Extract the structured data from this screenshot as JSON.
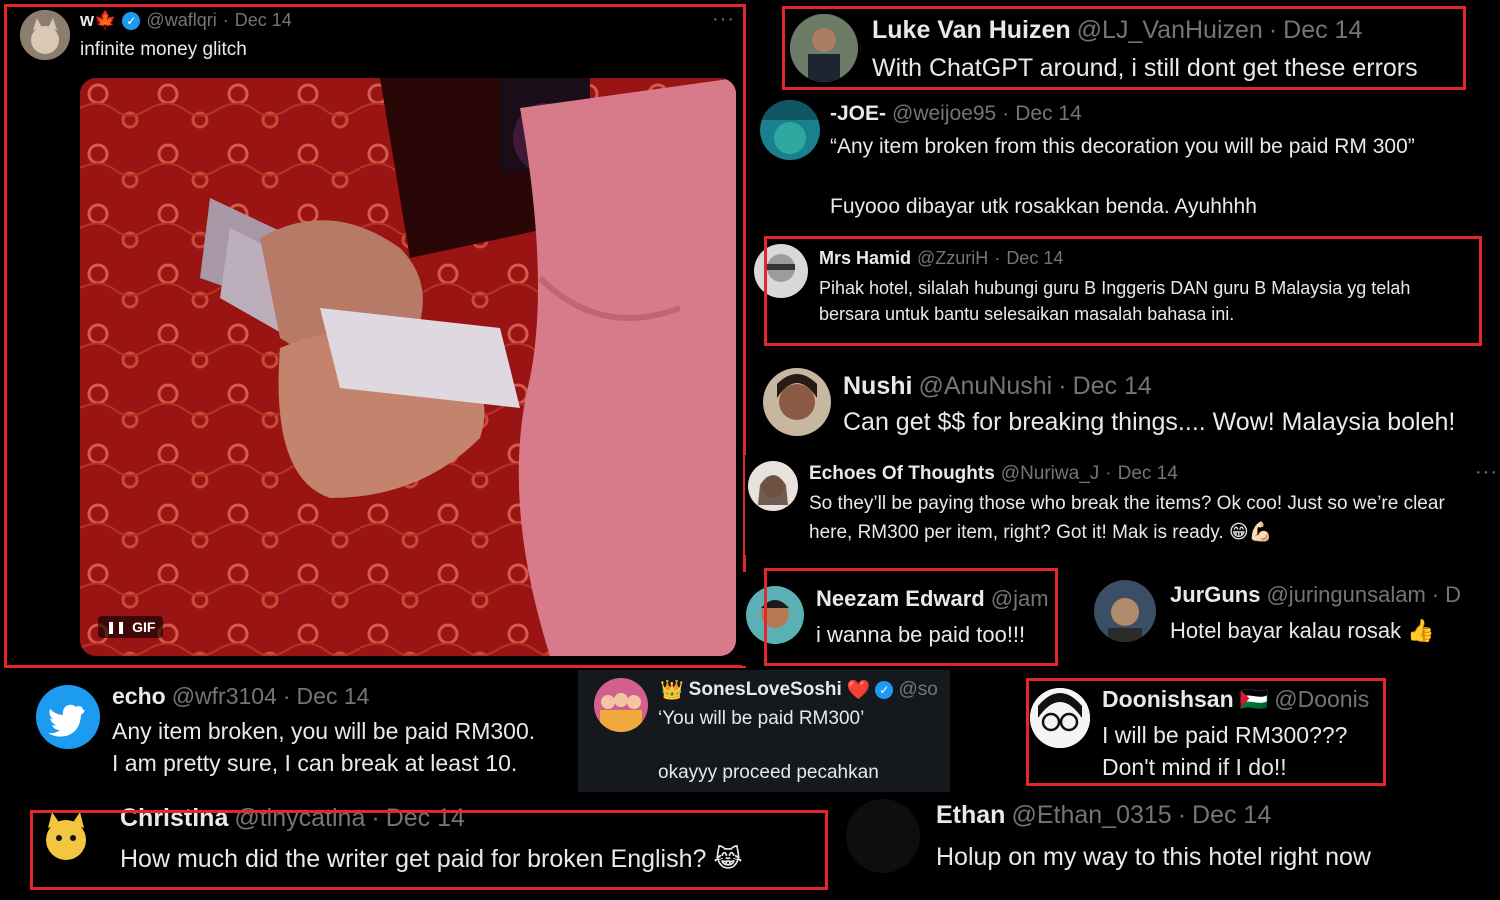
{
  "main_tweet": {
    "name": "w🍁",
    "handle": "@waflqri",
    "sep": "·",
    "date": "Dec 14",
    "text": "infinite money glitch",
    "more": "···",
    "media": {
      "badge": "GIF",
      "pause": "❚❚"
    }
  },
  "replies": [
    {
      "name": "Luke Van Huizen",
      "handle": "@LJ_VanHuizen",
      "sep": "·",
      "date": "Dec 14",
      "text": "With ChatGPT around, i still dont get these errors"
    },
    {
      "name": "-JOE-",
      "handle": "@weijoe95",
      "sep": "·",
      "date": "Dec 14",
      "line1": "“Any item broken from this decoration you will be paid RM 300”",
      "line2": "Fuyooo dibayar utk rosakkan benda. Ayuhhhh"
    },
    {
      "name": "Mrs Hamid",
      "handle": "@ZzuriH",
      "sep": "·",
      "date": "Dec 14",
      "line1": "Pihak hotel, silalah hubungi guru B Inggeris DAN guru B Malaysia yg telah",
      "line2": "bersara untuk bantu selesaikan masalah bahasa ini."
    },
    {
      "name": "Nushi",
      "handle": "@AnuNushi",
      "sep": "·",
      "date": "Dec 14",
      "text": "Can get $$ for breaking things.... Wow! Malaysia boleh!"
    },
    {
      "name": "Echoes Of Thoughts",
      "handle": "@Nuriwa_J",
      "sep": "·",
      "date": "Dec 14",
      "line1": "So they’ll be paying those who break the items? Ok coo! Just so we’re clear",
      "line2": "here, RM300 per item, right? Got it! Mak is ready. 😁💪🏻",
      "more": "···"
    },
    {
      "name": "Neezam Edward",
      "handle": "@jam",
      "text": "i wanna be paid too!!!"
    },
    {
      "name": "JurGuns",
      "handle": "@juringunsalam",
      "sep": "·",
      "date": "D",
      "text": "Hotel bayar kalau rosak 👍"
    },
    {
      "name": "echo",
      "handle": "@wfr3104",
      "sep": "·",
      "date": "Dec 14",
      "line1": "Any item broken, you will be paid RM300.",
      "line2": "I am pretty sure, I can break at least 10."
    },
    {
      "prefix": "👑",
      "name": "SonesLoveSoshi",
      "heart": "❤️",
      "handle": "@so",
      "line1": "‘You will be paid RM300’",
      "line2": "okayyy proceed pecahkan"
    },
    {
      "name": "Doonishsan",
      "flag": "🇵🇸",
      "handle": "@Doonis",
      "line1": "I will be paid RM300???",
      "line2": "Don't mind if I do!!"
    },
    {
      "name": "Christina",
      "handle": "@tinycatina",
      "sep": "·",
      "date": "Dec 14",
      "text": "How much did the writer get paid for broken English? 😹"
    },
    {
      "name": "Ethan",
      "handle": "@Ethan_0315",
      "sep": "·",
      "date": "Dec 14",
      "text": "Holup on my way to this hotel right now"
    }
  ],
  "colors": {
    "highlight": "#e3282d",
    "muted": "#71767b",
    "text": "#e7e9ea",
    "verified": "#1d9bf0"
  }
}
